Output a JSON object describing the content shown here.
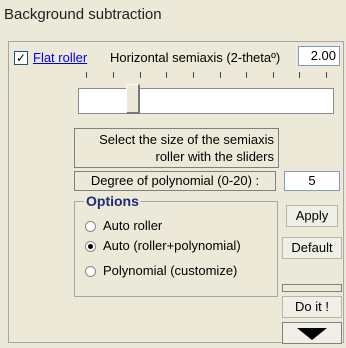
{
  "window": {
    "title": "Background subtraction"
  },
  "flat_roller": {
    "checked": true,
    "check_glyph": "✓",
    "label": "Flat roller"
  },
  "semiaxis": {
    "label": "Horizontal semiaxis (2-thetaº)",
    "value": "2.00",
    "slider_position": 0.2
  },
  "info": {
    "line1": "Select the size of the  semiaxis",
    "line2": "roller with the sliders"
  },
  "degree": {
    "label": "Degree of polynomial (0-20) :",
    "value": "5"
  },
  "options": {
    "legend": "Options",
    "items": [
      {
        "label": "Auto roller",
        "selected": false
      },
      {
        "label": "Auto (roller+polynomial)",
        "selected": true
      },
      {
        "label": "Polynomial (customize)",
        "selected": false
      }
    ]
  },
  "buttons": {
    "apply": "Apply",
    "default": "Default",
    "doit": "Do it !",
    "arrow_icon": "down-arrow-icon"
  }
}
